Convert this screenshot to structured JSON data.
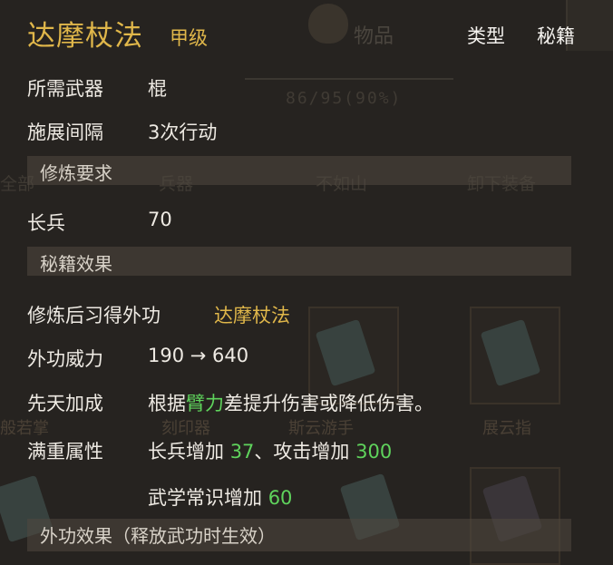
{
  "skill": {
    "name": "达摩杖法",
    "grade": "甲级",
    "type_label": "类型",
    "type_value": "秘籍"
  },
  "background": {
    "inventory_tab": "物品",
    "capacity": "86/95(90%)",
    "categories": [
      "全部",
      "兵器",
      "不如山",
      "卸下装备"
    ],
    "book_names": [
      "般若掌",
      "刻印器",
      "斯云游手",
      "展云指"
    ]
  },
  "attributes": {
    "weapon_label": "所需武器",
    "weapon_value": "棍",
    "interval_label": "施展间隔",
    "interval_value": "3次行动"
  },
  "training": {
    "section_title": "修炼要求",
    "req_label": "长兵",
    "req_value": "70"
  },
  "effects": {
    "section_title": "秘籍效果",
    "learn_label": "修炼后习得外功",
    "learn_value": "达摩杖法",
    "power_label": "外功威力",
    "power_value": "190 → 640",
    "innate_label": "先天加成",
    "innate_pre": "根据",
    "innate_attr": "臂力",
    "innate_post": "差提升伤害或降低伤害。",
    "full_label": "满重属性",
    "full_1_text": "长兵增加",
    "full_1_num": "37",
    "full_sep": "、",
    "full_2_text": "攻击增加",
    "full_2_num": "300",
    "full_3_text": "武学常识增加",
    "full_3_num": "60"
  },
  "external": {
    "section_title": "外功效果（释放武功时生效）"
  }
}
